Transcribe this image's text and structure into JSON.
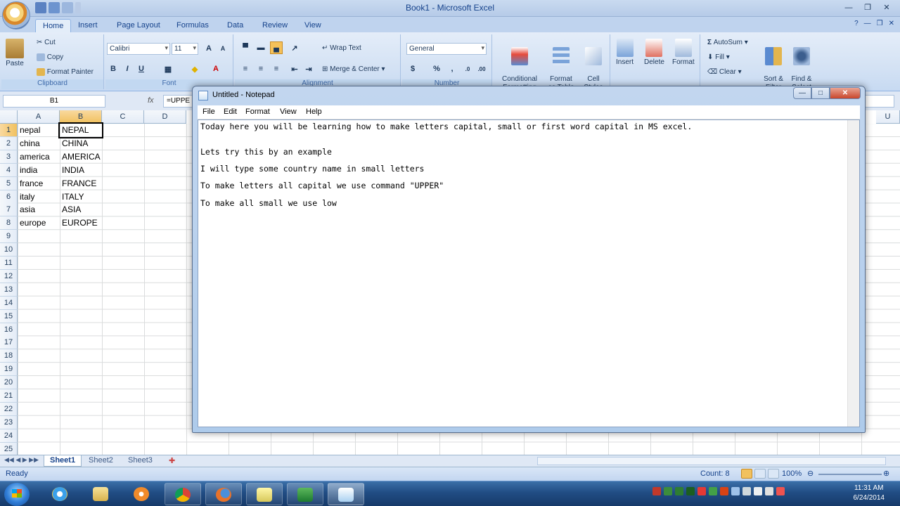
{
  "excel": {
    "window_title": "Book1 - Microsoft Excel",
    "tabs": [
      "Home",
      "Insert",
      "Page Layout",
      "Formulas",
      "Data",
      "Review",
      "View"
    ],
    "clipboard": {
      "paste": "Paste",
      "cut": "Cut",
      "copy": "Copy",
      "format_painter": "Format Painter",
      "label": "Clipboard"
    },
    "font": {
      "name": "Calibri",
      "size": "11",
      "label": "Font"
    },
    "alignment": {
      "wrap_text": "Wrap Text",
      "merge_center": "Merge & Center",
      "label": "Alignment"
    },
    "number": {
      "format": "General",
      "label": "Number"
    },
    "styles": {
      "conditional": "Conditional\nFormatting",
      "format_table": "Format\nas Table",
      "cell_styles": "Cell\nStyles",
      "label": "Styles"
    },
    "cells": {
      "insert": "Insert",
      "delete": "Delete",
      "format": "Format",
      "label": "Cells"
    },
    "editing": {
      "autosum": "AutoSum",
      "fill": "Fill",
      "clear": "Clear",
      "sort_filter": "Sort &\nFilter",
      "find_select": "Find &\nSelect",
      "label": "Editing"
    },
    "namebox": "B1",
    "formula": "=UPPE",
    "columns": [
      "A",
      "B",
      "C",
      "D"
    ],
    "rows": [
      "1",
      "2",
      "3",
      "4",
      "5",
      "6",
      "7",
      "8",
      "9",
      "10",
      "11",
      "12",
      "13",
      "14",
      "15",
      "16",
      "17",
      "18",
      "19",
      "20",
      "21",
      "22",
      "23",
      "24",
      "25"
    ],
    "col_a": [
      "nepal",
      "china",
      "america",
      "india",
      "france",
      "italy",
      "asia",
      "europe"
    ],
    "col_b": [
      "NEPAL",
      "CHINA",
      "AMERICA",
      "INDIA",
      "FRANCE",
      "ITALY",
      "ASIA",
      "EUROPE"
    ],
    "sheets": [
      "Sheet1",
      "Sheet2",
      "Sheet3"
    ],
    "status": {
      "ready": "Ready",
      "count": "Count: 8",
      "zoom": "100%"
    }
  },
  "notepad": {
    "title": "Untitled - Notepad",
    "menu": [
      "File",
      "Edit",
      "Format",
      "View",
      "Help"
    ],
    "lines": [
      "Today here you will be learning how to make letters capital, small or first word capital in MS excel.",
      "Lets try this by an example",
      "I will type some country name in small letters",
      "To make letters all capital we use command \"UPPER\"",
      "To make all small we use low"
    ]
  },
  "taskbar": {
    "time": "11:31 AM",
    "date": "6/24/2014"
  }
}
